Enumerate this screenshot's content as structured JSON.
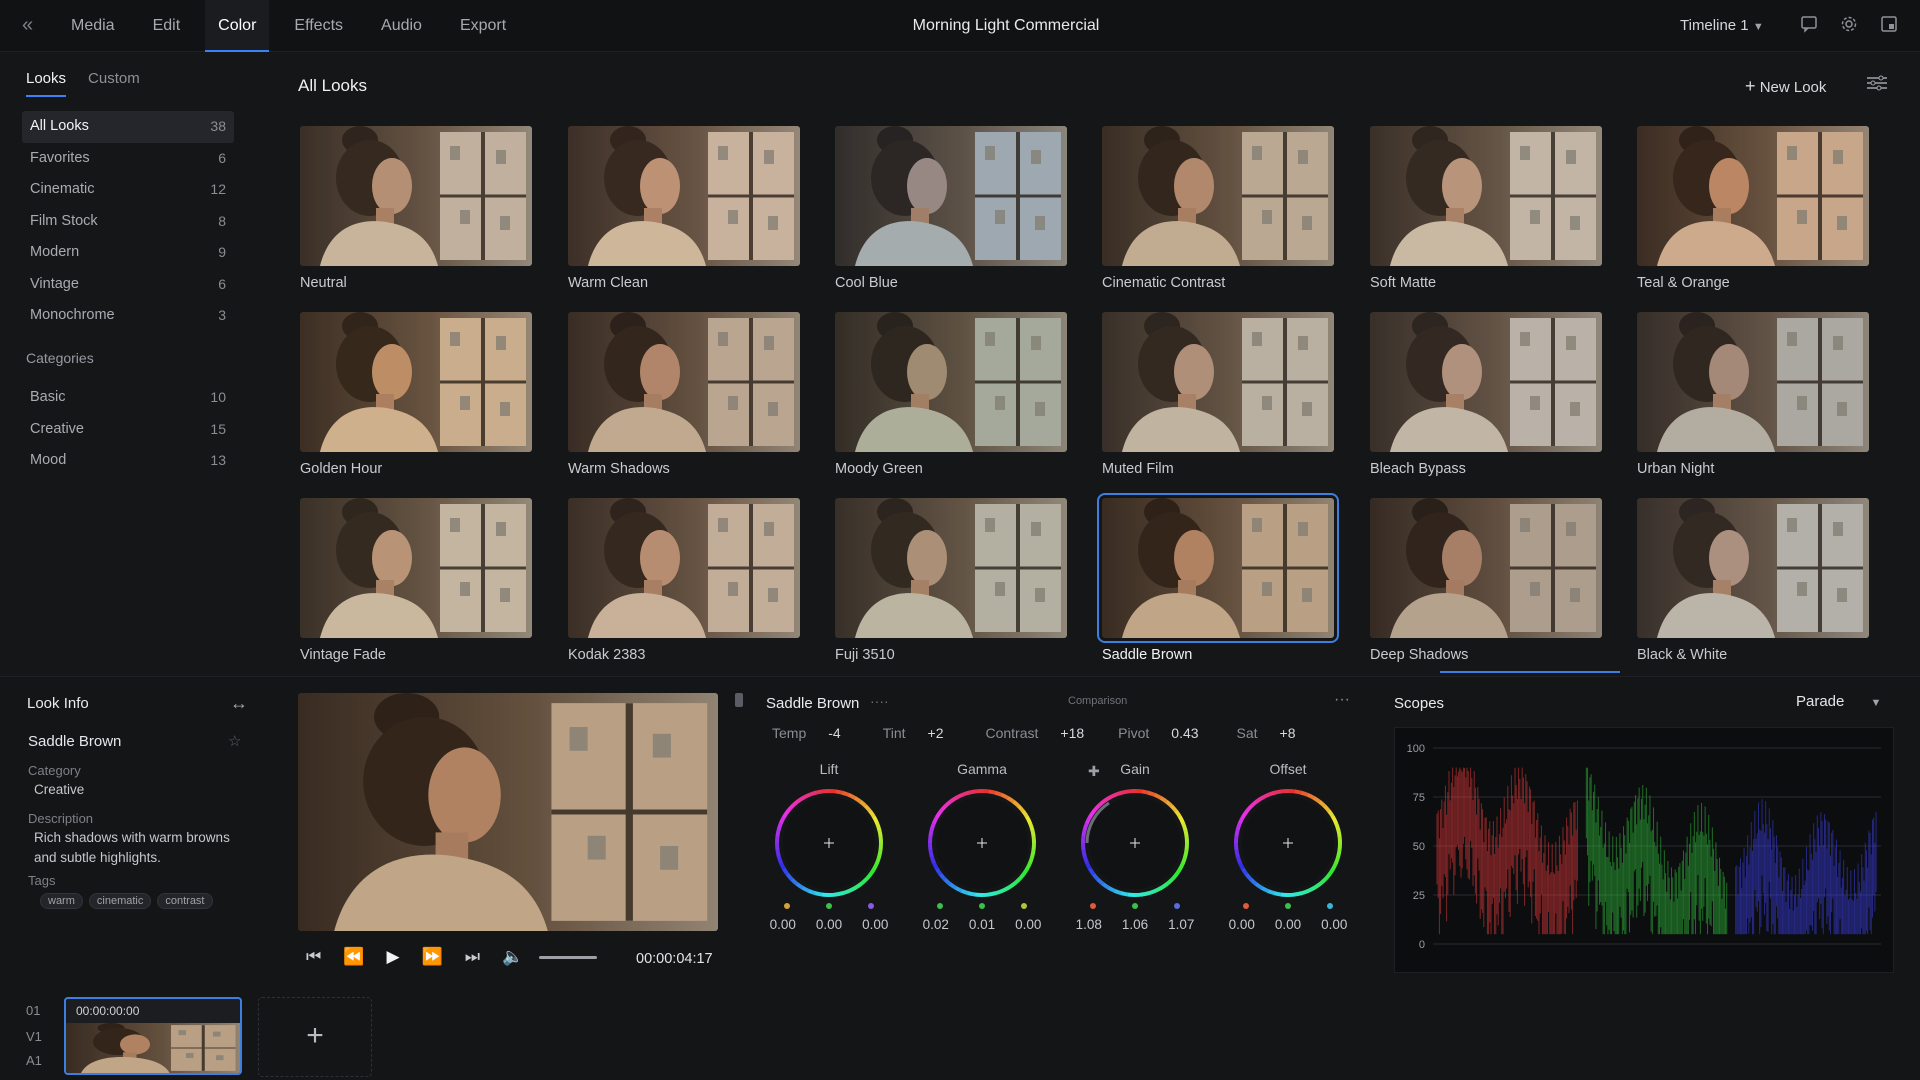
{
  "app": {
    "back_icon": "back-chevrons-icon",
    "project_title": "Morning Light Commercial",
    "nav": [
      "Media",
      "Edit",
      "Color",
      "Effects",
      "Audio",
      "Export"
    ],
    "active_nav": "Color",
    "timeline": "Timeline 1",
    "icons": [
      "comment-icon",
      "settings-gear-icon",
      "window-icon"
    ]
  },
  "sidebar": {
    "tabs": [
      "Looks",
      "Custom"
    ],
    "active_tab": "Looks",
    "items": [
      {
        "label": "All Looks",
        "count": "38"
      },
      {
        "label": "Favorites",
        "count": "6"
      },
      {
        "label": "Cinematic",
        "count": "12"
      },
      {
        "label": "Film Stock",
        "count": "8"
      },
      {
        "label": "Modern",
        "count": "9"
      },
      {
        "label": "Vintage",
        "count": "6"
      },
      {
        "label": "Monochrome",
        "count": "3"
      }
    ],
    "categories_label": "Categories",
    "categories": [
      {
        "label": "Basic",
        "count": "10"
      },
      {
        "label": "Creative",
        "count": "15"
      },
      {
        "label": "Mood",
        "count": "13"
      }
    ]
  },
  "looks": {
    "title": "All Looks",
    "new_look": "New Look",
    "selected": "Saddle Brown",
    "items": [
      {
        "name": "Neutral",
        "tint": "#b39a80"
      },
      {
        "name": "Warm Clean",
        "tint": "#c4a080"
      },
      {
        "name": "Cool Blue",
        "tint": "#6f8aa8"
      },
      {
        "name": "Cinematic Contrast",
        "tint": "#a88a6e"
      },
      {
        "name": "Soft Matte",
        "tint": "#b9a590"
      },
      {
        "name": "Teal & Orange",
        "tint": "#c0875e"
      },
      {
        "name": "Golden Hour",
        "tint": "#c49560"
      },
      {
        "name": "Warm Shadows",
        "tint": "#a78468"
      },
      {
        "name": "Moody Green",
        "tint": "#7e8f7e"
      },
      {
        "name": "Muted Film",
        "tint": "#a59a8c"
      },
      {
        "name": "Bleach Bypass",
        "tint": "#a7a097"
      },
      {
        "name": "Urban Night",
        "tint": "#8a8a8c"
      },
      {
        "name": "Vintage Fade",
        "tint": "#b9a386"
      },
      {
        "name": "Kodak 2383",
        "tint": "#b6957a"
      },
      {
        "name": "Fuji 3510",
        "tint": "#999a8a"
      },
      {
        "name": "Saddle Brown",
        "tint": "#a57a55"
      },
      {
        "name": "Deep Shadows",
        "tint": "#8e7560"
      },
      {
        "name": "Black & White",
        "tint": "#9a9a9a"
      }
    ]
  },
  "look_info": {
    "title": "Look Info",
    "name": "Saddle Brown",
    "category_label": "Category",
    "category": "Creative",
    "description_label": "Description",
    "description": "Rich shadows with warm browns and subtle highlights.",
    "tags_label": "Tags",
    "tags": [
      "warm",
      "cinematic",
      "contrast"
    ]
  },
  "player": {
    "timecode": "00:00:04:17",
    "volume": 0.9,
    "icons": [
      "skip-to-start-icon",
      "step-back-icon",
      "play-icon",
      "fast-forward-icon",
      "skip-to-end-icon",
      "volume-icon"
    ]
  },
  "clips": {
    "track_number": "01",
    "video_track": "V1",
    "audio_track": "A1",
    "clip_timecode": "00:00:00:00",
    "add_icon": "plus-icon"
  },
  "grade": {
    "title": "Saddle Brown",
    "mid_label": "Comparison",
    "params": [
      {
        "label": "Temp",
        "value": "-4"
      },
      {
        "label": "Tint",
        "value": "+2"
      },
      {
        "label": "Contrast",
        "value": "+18"
      },
      {
        "label": "Pivot",
        "value": "0.43"
      },
      {
        "label": "Sat",
        "value": "+8"
      }
    ],
    "wheels": [
      {
        "label": "Lift",
        "values": [
          "0.00",
          "0.00",
          "0.00"
        ]
      },
      {
        "label": "Gamma",
        "values": [
          "0.02",
          "0.01",
          "0.00"
        ]
      },
      {
        "label": "Gain",
        "values": [
          "1.08",
          "1.06",
          "1.07"
        ]
      },
      {
        "label": "Offset",
        "values": [
          "0.00",
          "0.00",
          "0.00"
        ]
      }
    ]
  },
  "scopes": {
    "title": "Scopes",
    "mode": "Parade",
    "ticks": [
      "100",
      "75",
      "50",
      "25",
      "0"
    ],
    "channel_colors": [
      "#e23b3b",
      "#2fc03a",
      "#3b3fe0"
    ]
  },
  "colors": {
    "accent": "#3b82f6",
    "background": "#151618"
  }
}
